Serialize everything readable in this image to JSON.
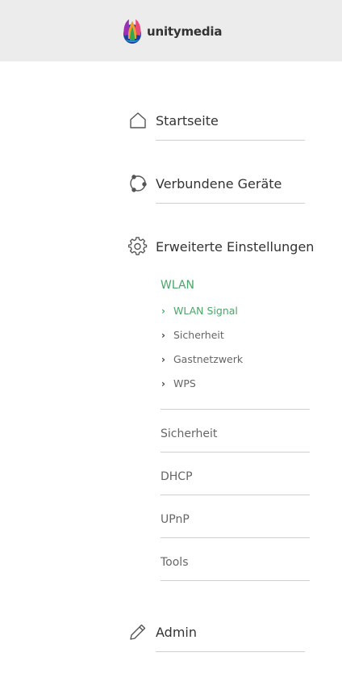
{
  "header": {
    "brand": "unitymedia"
  },
  "nav": {
    "home": "Startseite",
    "devices": "Verbundene Geräte",
    "advanced": "Erweiterte Einstellungen",
    "admin": "Admin"
  },
  "advanced": {
    "wlan_title": "WLAN",
    "wlan_links": [
      "WLAN Signal",
      "Sicherheit",
      "Gastnetzwerk",
      "WPS"
    ],
    "sections": [
      "Sicherheit",
      "DHCP",
      "UPnP",
      "Tools"
    ]
  },
  "colors": {
    "accent": "#4aa66a",
    "header_bg": "#ececec",
    "text": "#333333",
    "muted": "#666666"
  },
  "icons": {
    "home": "house-icon",
    "devices": "devices-icon",
    "advanced": "gear-icon",
    "admin": "pencil-icon",
    "chevron": "chevron-right-icon"
  }
}
